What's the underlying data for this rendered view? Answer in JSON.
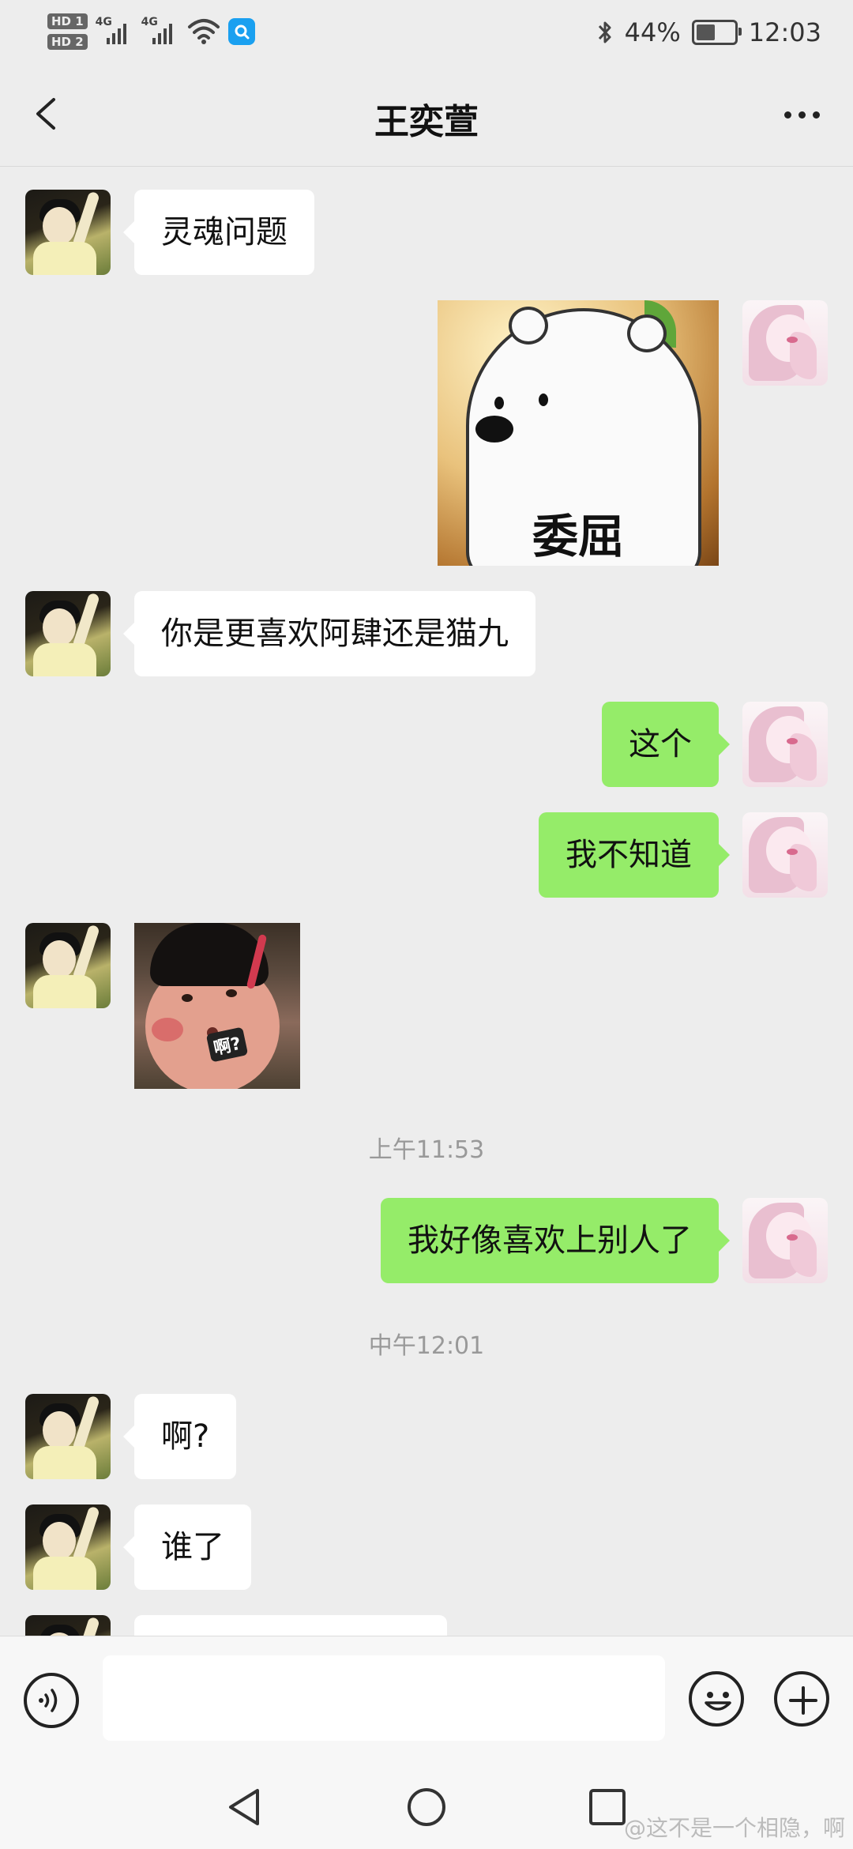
{
  "status_bar": {
    "sim1": "HD 1",
    "sim2": "HD 2",
    "network1": "4G",
    "network2": "4G",
    "battery_percent": "44%",
    "battery_level": 0.44,
    "time": "12:03",
    "icons": [
      "signal-icon",
      "wifi-icon",
      "search-app-icon",
      "bluetooth-icon",
      "battery-icon"
    ]
  },
  "header": {
    "title": "王奕萱",
    "back_icon": "chevron-left-icon",
    "more_icon": "more-icon"
  },
  "messages": [
    {
      "side": "left",
      "type": "text",
      "text": "灵魂问题"
    },
    {
      "side": "right",
      "type": "sticker",
      "caption": "委屈"
    },
    {
      "side": "left",
      "type": "text",
      "text": "你是更喜欢阿肆还是猫九"
    },
    {
      "side": "right",
      "type": "text",
      "text": "这个"
    },
    {
      "side": "right",
      "type": "text",
      "text": "我不知道"
    },
    {
      "side": "left",
      "type": "sticker",
      "caption": "啊?"
    },
    {
      "type": "timestamp",
      "text": "上午11:53"
    },
    {
      "side": "right",
      "type": "text",
      "text": "我好像喜欢上别人了"
    },
    {
      "type": "timestamp",
      "text": "中午12:01"
    },
    {
      "side": "left",
      "type": "text",
      "text": "啊?"
    },
    {
      "side": "left",
      "type": "text",
      "text": "谁了"
    }
  ],
  "input_bar": {
    "voice_icon": "voice-icon",
    "input_value": "",
    "emoji_icon": "emoji-icon",
    "plus_icon": "plus-icon"
  },
  "nav_bar": {
    "icons": [
      "back-triangle-icon",
      "home-circle-icon",
      "recent-square-icon"
    ],
    "watermark": "@这不是一个相隐，啊"
  },
  "colors": {
    "background": "#ededed",
    "sent_bubble": "#95ec69",
    "received_bubble": "#ffffff",
    "timestamp": "#999999"
  }
}
